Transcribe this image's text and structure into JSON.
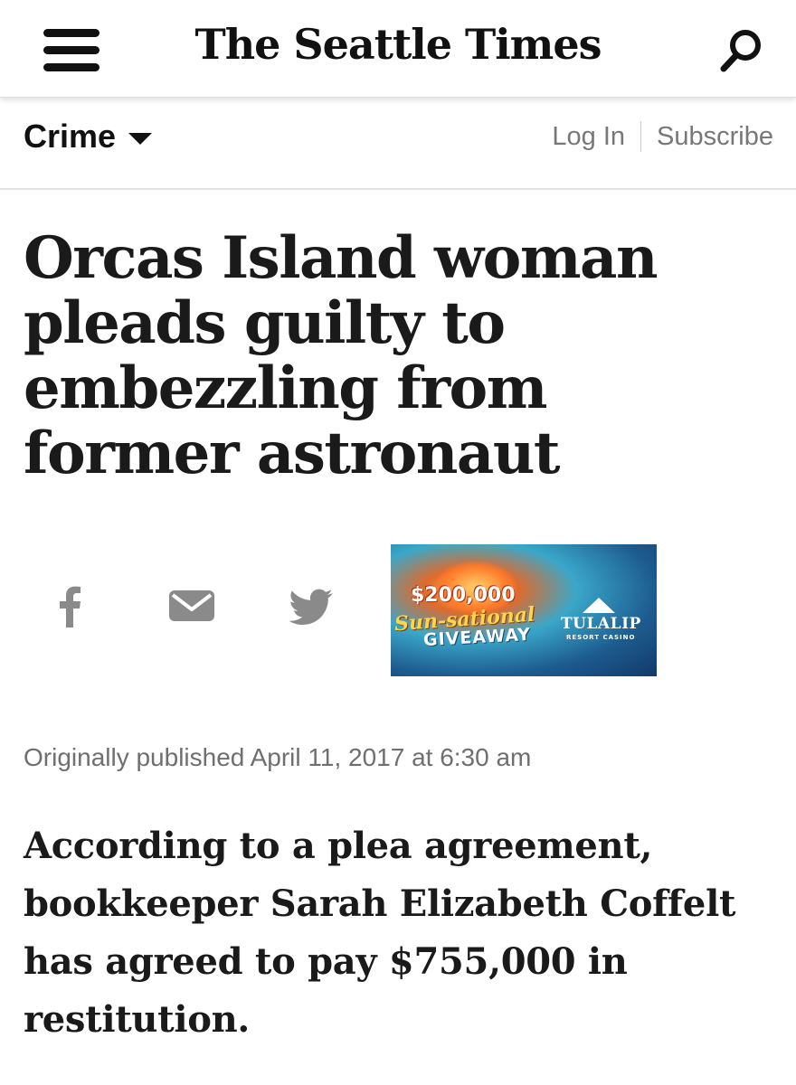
{
  "header": {
    "masthead": "The Seattle Times",
    "menu_icon": "hamburger-menu-icon",
    "search_icon": "search-icon"
  },
  "subnav": {
    "section": "Crime",
    "login": "Log In",
    "subscribe": "Subscribe"
  },
  "article": {
    "headline": "Orcas Island woman pleads guilty to embezzling from former astronaut",
    "published": "Originally published April 11, 2017 at 6:30 am",
    "summary": "According to a plea agreement, bookkeeper Sarah Elizabeth Coffelt has agreed to pay $755,000 in restitution."
  },
  "share": {
    "facebook_icon": "facebook-icon",
    "email_icon": "email-icon",
    "twitter_icon": "twitter-icon"
  },
  "ad": {
    "amount": "$200,000",
    "line1": "Sun-sational",
    "line2": "GIVEAWAY",
    "brand": "TULALIP",
    "brand_sub": "RESORT CASINO"
  },
  "colors": {
    "text": "#1a1a1a",
    "muted": "#6f6f6f",
    "icon_gray": "#8a8a8a"
  }
}
